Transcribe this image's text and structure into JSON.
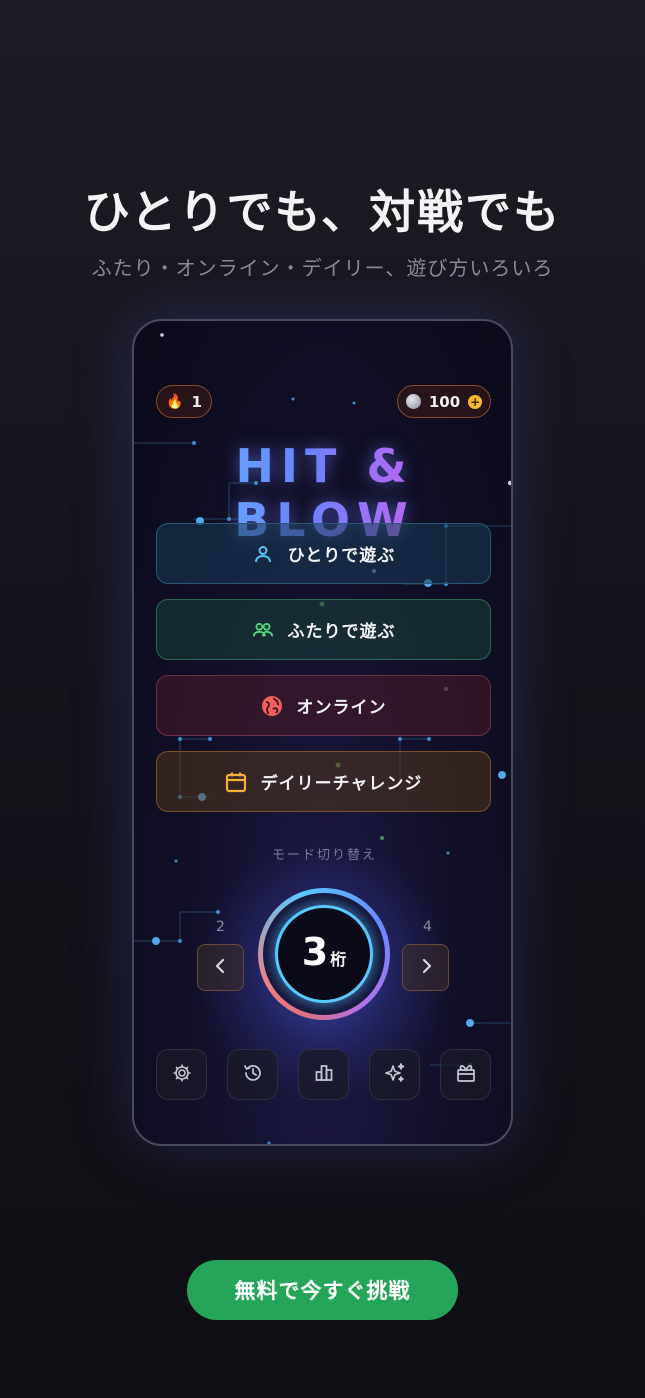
{
  "promo": {
    "headline": "ひとりでも、対戦でも",
    "subline": "ふたり・オンライン・デイリー、遊び方いろいろ",
    "cta_label": "無料で今すぐ挑戦"
  },
  "app": {
    "streak_count": "1",
    "streak_icon": "flame-icon",
    "coin_count": "100",
    "coin_icon": "moon-icon",
    "coin_add_icon": "plus-circle-icon",
    "logo": "HIT & BLOW",
    "modes": [
      {
        "label": "ひとりで遊ぶ",
        "icon": "user-icon",
        "color": "#4fc3f7"
      },
      {
        "label": "ふたりで遊ぶ",
        "icon": "users-icon",
        "color": "#4ade80"
      },
      {
        "label": "オンライン",
        "icon": "globe-icon",
        "color": "#f25f5c"
      },
      {
        "label": "デイリーチャレンジ",
        "icon": "calendar-icon",
        "color": "#f6b03a"
      }
    ],
    "mode_switch_label": "モード切り替え",
    "digit_selector": {
      "current": "3",
      "unit": "桁",
      "prev": "2",
      "next": "4"
    },
    "bottom_icons": [
      "settings-icon",
      "history-icon",
      "leaderboard-icon",
      "sparkles-icon",
      "gift-icon"
    ]
  },
  "colors": {
    "cta": "#25a559",
    "ring_inner": "#58c8ff"
  }
}
